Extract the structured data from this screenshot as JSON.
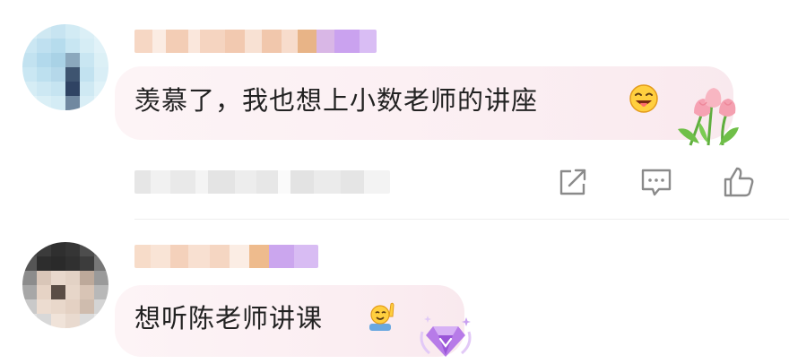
{
  "comments": [
    {
      "text": "羡慕了，我也想上小数老师的讲座",
      "emoji": "face-savoring-food",
      "decoration": "tulip-bouquet",
      "actions": {
        "share_icon": "share-icon",
        "reply_icon": "comment-icon",
        "like_icon": "thumbs-up-icon"
      }
    },
    {
      "text": "想听陈老师讲课",
      "emoji": "raising-hand",
      "decoration": "purple-gem-badge"
    }
  ],
  "colors": {
    "text": "#222222",
    "icon": "#8a8a8a",
    "bubble": "#fbeef2",
    "badge_purple": "#c79df0"
  }
}
